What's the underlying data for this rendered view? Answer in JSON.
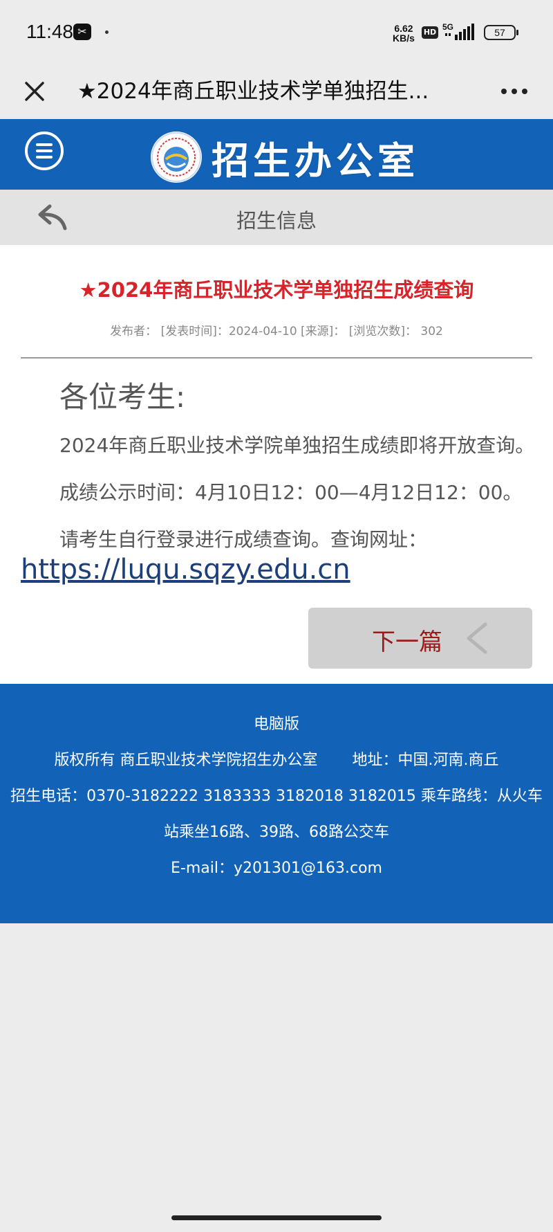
{
  "status_bar": {
    "time": "11:48",
    "app_icon": "capcut-icon",
    "net_speed_value": "6.62",
    "net_speed_unit": "KB/s",
    "hd": "HD",
    "network": "5G",
    "battery": "57"
  },
  "browser": {
    "page_title": "★2024年商丘职业技术学单独招生...",
    "close_icon": "close-icon",
    "more_icon": "more-icon"
  },
  "site_header": {
    "title": "招生办公室",
    "menu_icon": "menu-icon",
    "logo": "school-logo",
    "color": "#1262b7"
  },
  "section": {
    "title": "招生信息",
    "back_icon": "back-arrow-icon"
  },
  "article": {
    "title": "★2024年商丘职业技术学单独招生成绩查询",
    "meta": "发布者： [发表时间]：2024-04-10 [来源]： [浏览次数]： 302",
    "title_color": "#d9232b",
    "greeting": "各位考生:",
    "paragraph_1": "2024年商丘职业技术学院单独招生成绩即将开放查询。",
    "paragraph_2": "成绩公示时间：4月10日12：00—4月12日12：00。",
    "paragraph_3": "请考生自行登录进行成绩查询。查询网址：",
    "link": "https://luqu.sqzy.edu.cn",
    "next_button": "下一篇"
  },
  "footer": {
    "desktop_version": "电脑版",
    "copyright": "版权所有 商丘职业技术学院招生办公室",
    "address": "地址：中国.河南.商丘",
    "phone_line": "招生电话：0370-3182222 3183333 3182018 3182015 乘车路线：从火车",
    "route_line": "站乘坐16路、39路、68路公交车",
    "email": "E-mail：y201301@163.com"
  }
}
